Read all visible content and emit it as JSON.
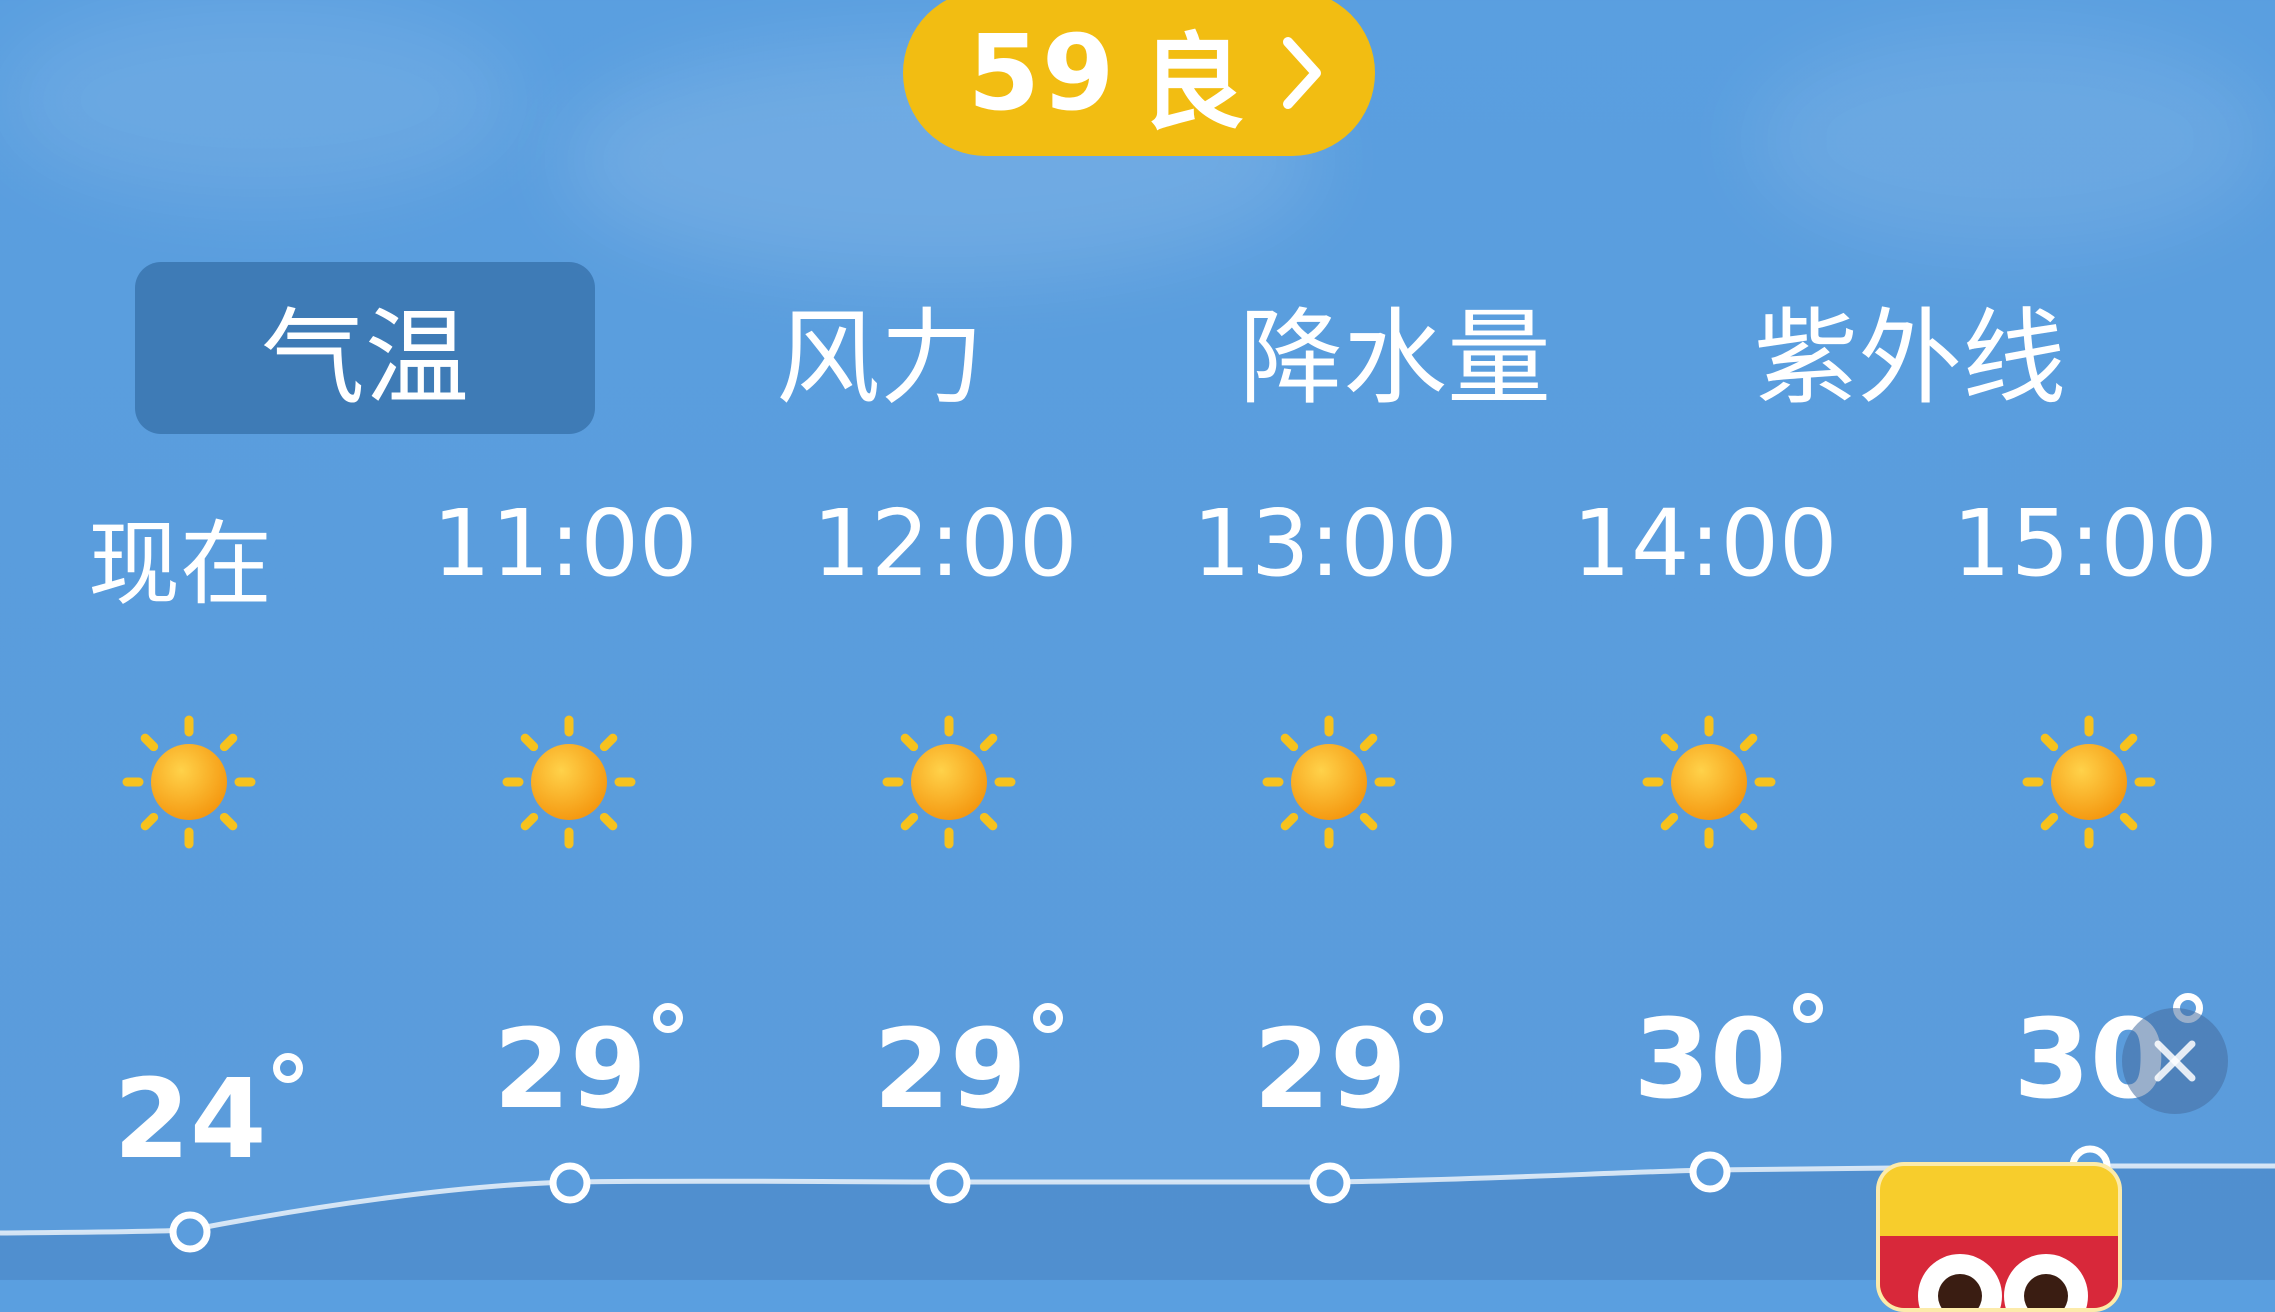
{
  "aqi": {
    "value": "59",
    "level": "良"
  },
  "tabs": [
    {
      "label": "气温",
      "active": true
    },
    {
      "label": "风力",
      "active": false
    },
    {
      "label": "降水量",
      "active": false
    },
    {
      "label": "紫外线",
      "active": false
    }
  ],
  "forecast": [
    {
      "time": "现在",
      "icon": "sun-icon",
      "temp": "24"
    },
    {
      "time": "11:00",
      "icon": "sun-icon",
      "temp": "29"
    },
    {
      "time": "12:00",
      "icon": "sun-icon",
      "temp": "29"
    },
    {
      "time": "13:00",
      "icon": "sun-icon",
      "temp": "29"
    },
    {
      "time": "14:00",
      "icon": "sun-icon",
      "temp": "30"
    },
    {
      "time": "15:00",
      "icon": "sun-icon",
      "temp": "30"
    }
  ],
  "colors": {
    "background": "#5b9ddd",
    "aqi_pill": "#f2bd12",
    "sun": "#f7b21a"
  }
}
